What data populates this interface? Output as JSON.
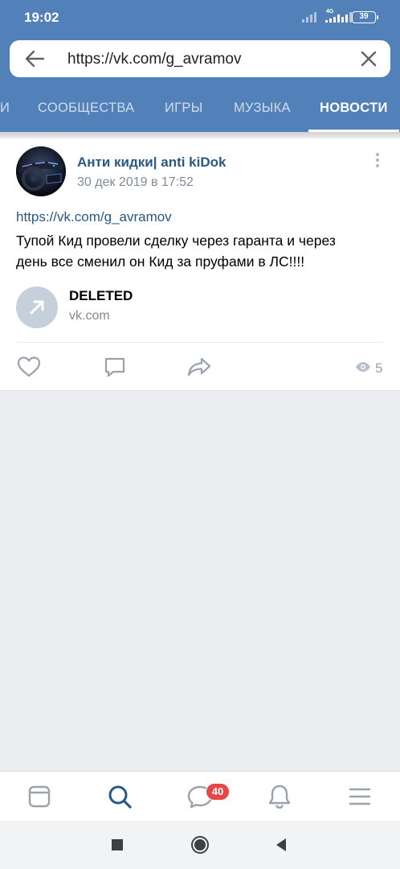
{
  "status_bar": {
    "time": "19:02",
    "network": "4G",
    "battery": "39"
  },
  "url_bar": {
    "url": "https://vk.com/g_avramov",
    "back_icon": "arrow-left-icon",
    "clear_icon": "close-icon"
  },
  "tabs": [
    {
      "label": "И"
    },
    {
      "label": "СООБЩЕСТВА"
    },
    {
      "label": "ИГРЫ"
    },
    {
      "label": "МУЗЫКА"
    },
    {
      "label": "НОВОСТИ",
      "active": true
    }
  ],
  "post": {
    "author": "Анти кидки| anti kiDok",
    "date": "30 дек 2019 в 17:52",
    "link": "https://vk.com/g_avramov",
    "text_line1": "Тупой Кид провели сделку через гаранта и через",
    "text_line2": "день все сменил он Кид за пруфами в ЛС!!!!",
    "attachment": {
      "title": "DELETED",
      "domain": "vk.com",
      "icon": "external-link-arrow-icon"
    },
    "actions": [
      "heart-icon",
      "comment-icon",
      "share-icon"
    ],
    "views": "5"
  },
  "bottom_nav": {
    "items": [
      "feed-icon",
      "search-icon",
      "messages-icon",
      "notifications-icon",
      "menu-icon"
    ],
    "messages_badge": "40",
    "active_color": "#2a5885"
  },
  "colors": {
    "header": "#5181b8",
    "link": "#2a5885",
    "secondary_text": "#818c99",
    "badge": "#e64646",
    "background": "#ebedf0"
  }
}
